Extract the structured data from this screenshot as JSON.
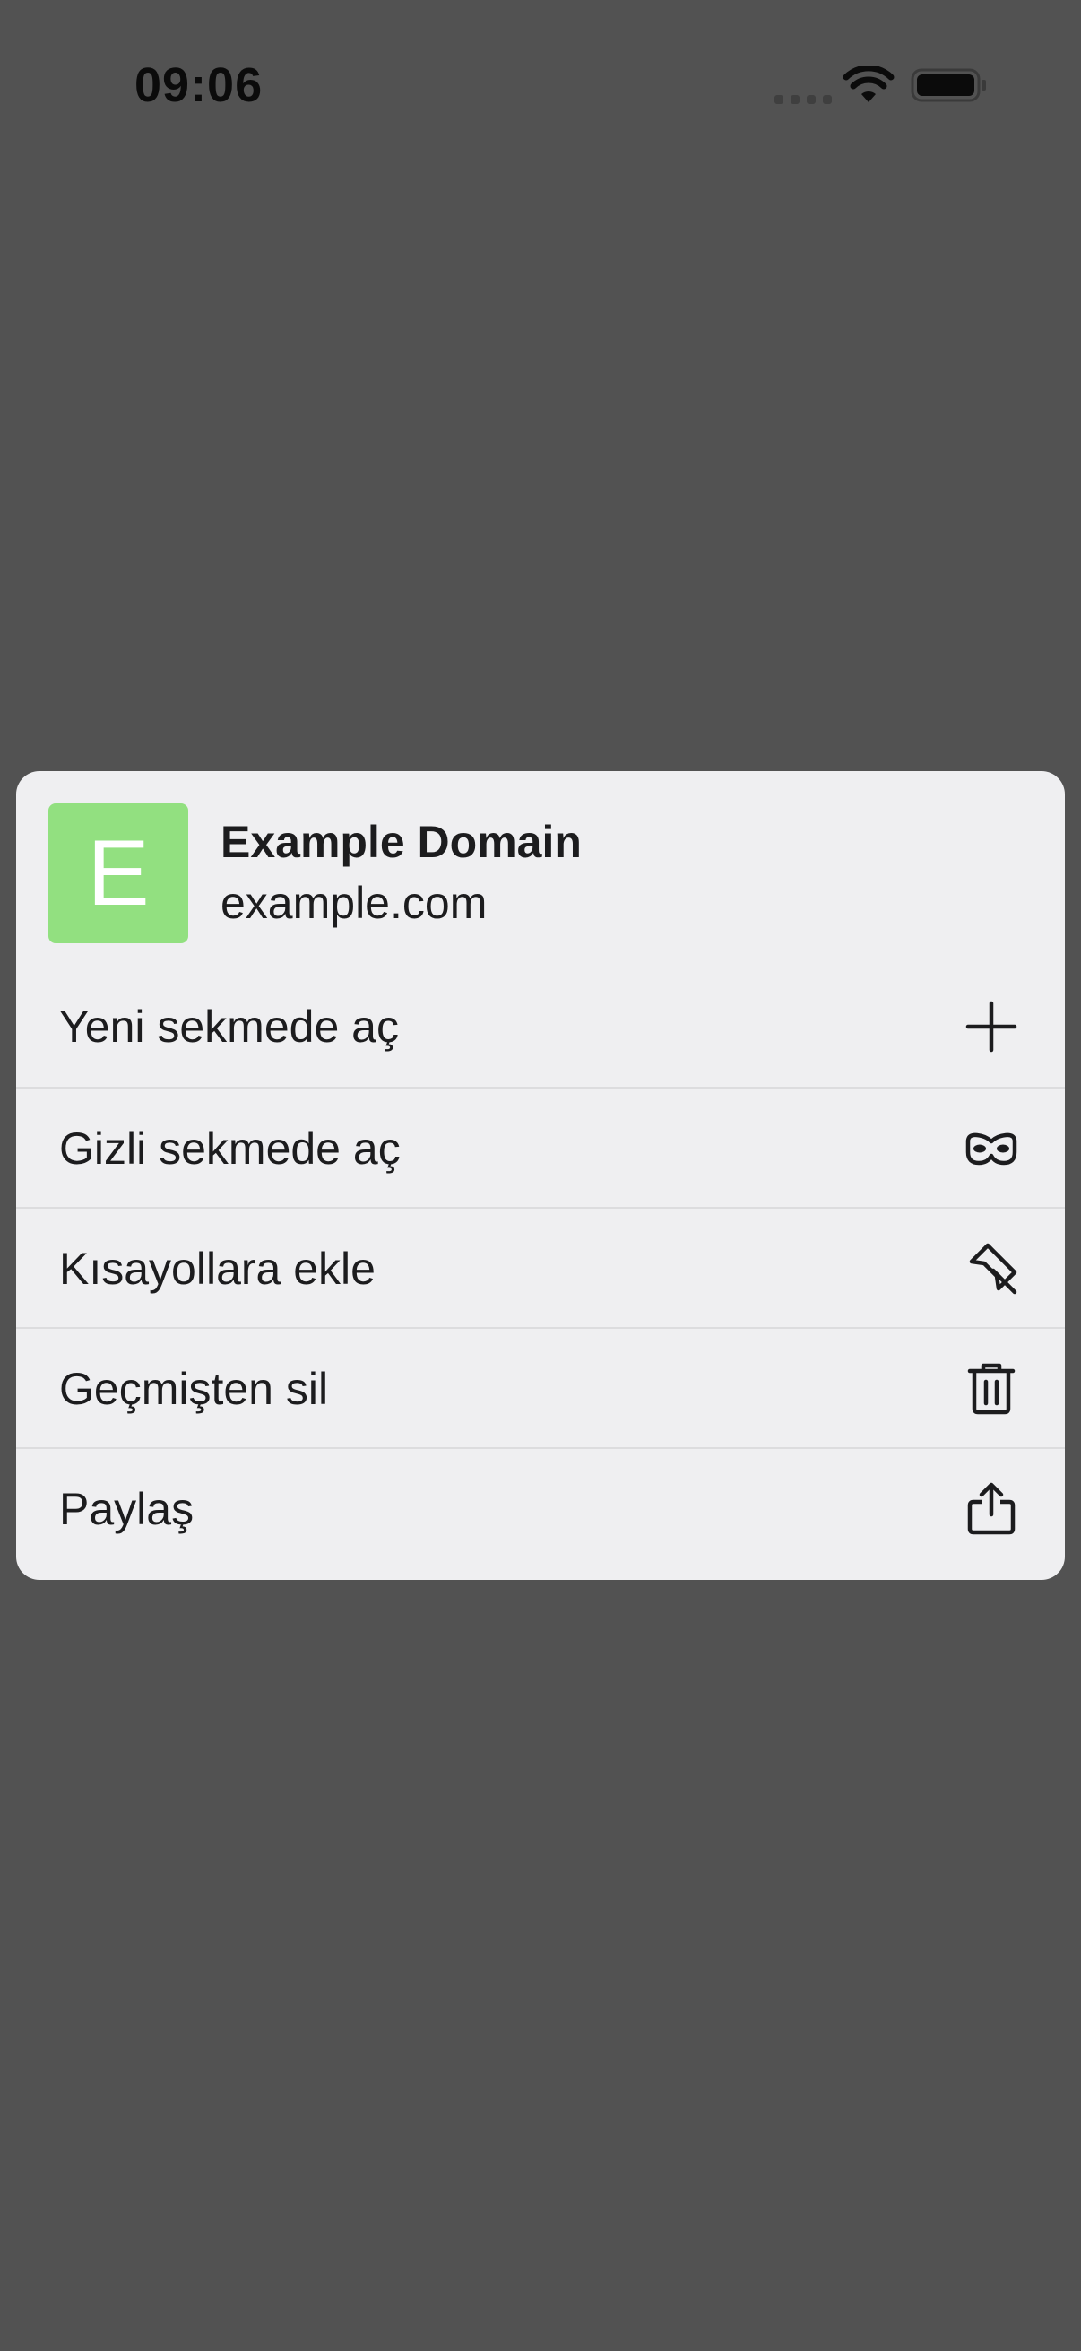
{
  "status_bar": {
    "time": "09:06",
    "icons": [
      "cellular-dots-icon",
      "wifi-icon",
      "battery-icon"
    ]
  },
  "menu": {
    "site": {
      "avatar_letter": "E",
      "avatar_color": "#92e080",
      "title": "Example Domain",
      "domain": "example.com"
    },
    "items": [
      {
        "label": "Yeni sekmede aç",
        "icon": "plus-icon"
      },
      {
        "label": "Gizli sekmede aç",
        "icon": "incognito-mask-icon"
      },
      {
        "label": "Kısayollara ekle",
        "icon": "pin-icon"
      },
      {
        "label": "Geçmişten sil",
        "icon": "trash-icon"
      },
      {
        "label": "Paylaş",
        "icon": "share-icon"
      }
    ]
  },
  "colors": {
    "backdrop": "#525252",
    "card": "#efeff1",
    "text": "#1c1c1e"
  }
}
